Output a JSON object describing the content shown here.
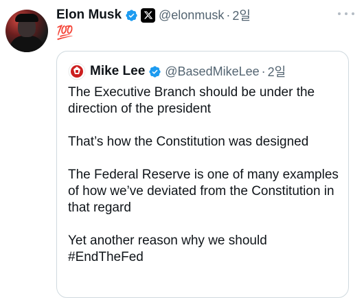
{
  "tweet": {
    "author_name": "Elon Musk",
    "author_handle": "@elonmusk",
    "separator": "·",
    "time": "2일",
    "text": "💯",
    "icons": {
      "verified": "verified-badge-icon",
      "x": "x-logo-icon",
      "more": "more-options-icon"
    }
  },
  "quote": {
    "author_name": "Mike Lee",
    "author_handle": "@BasedMikeLee",
    "separator": "·",
    "time": "2일",
    "paragraphs": [
      "The Executive Branch should be under the direction of the president",
      "That’s how the Constitution was designed",
      "The Federal Reserve is one of many examples of how we’ve deviated from the Constitution in that regard",
      "Yet another reason why we should #EndTheFed"
    ]
  },
  "colors": {
    "verified_blue": "#1d9bf0",
    "secondary_text": "#536471",
    "border": "#cfd9de",
    "primary_text": "#0f1419"
  }
}
